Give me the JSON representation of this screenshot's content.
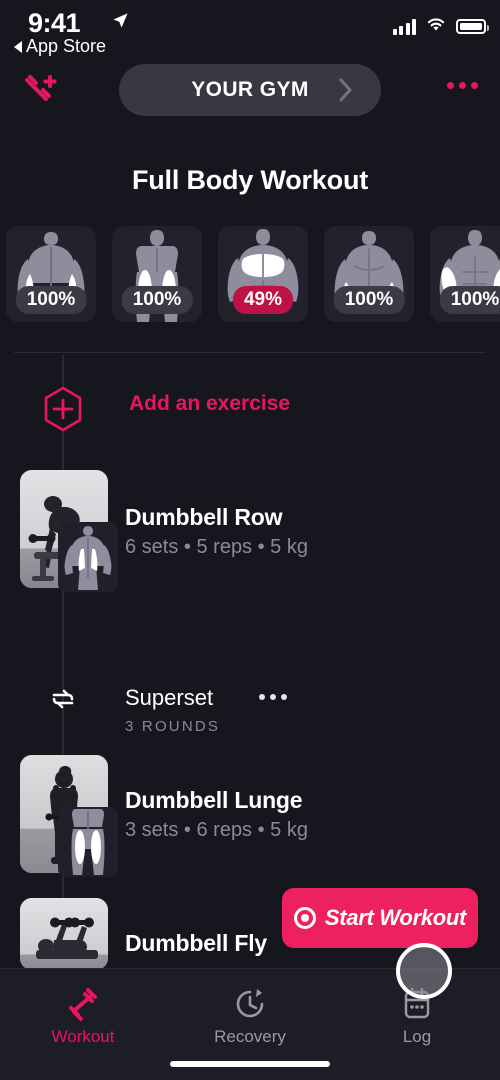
{
  "status_bar": {
    "time": "9:41",
    "back_label": "App Store",
    "location_icon": "location-arrow-icon",
    "signal_icon": "cellular-signal-icon",
    "wifi_icon": "wifi-icon",
    "battery_icon": "battery-full-icon"
  },
  "header": {
    "add_workout_icon": "dumbbell-plus-icon",
    "gym_label": "YOUR GYM",
    "gym_chevron_icon": "chevron-right-icon",
    "overflow_icon": "more-horizontal-icon"
  },
  "workout": {
    "title": "Full Body Workout",
    "muscle_cards": [
      {
        "name": "triceps-back",
        "percent": "100%",
        "highlight": false
      },
      {
        "name": "quadriceps-front",
        "percent": "100%",
        "highlight": false
      },
      {
        "name": "chest-front",
        "percent": "49%",
        "highlight": true
      },
      {
        "name": "triceps-rear",
        "percent": "100%",
        "highlight": false
      },
      {
        "name": "biceps-front",
        "percent": "100%",
        "highlight": false
      }
    ],
    "add_exercise": {
      "icon": "hexagon-plus-icon",
      "label": "Add an exercise"
    },
    "exercises": [
      {
        "name": "Dumbbell Row",
        "meta": "6 sets • 5 reps • 5 kg",
        "thumbnail": "person-bent-over-row-photo",
        "muscle_badge": "back-lats-diagram"
      },
      {
        "name": "Dumbbell Lunge",
        "meta": "3 sets • 6 reps • 5 kg",
        "thumbnail": "person-standing-dumbbells-photo",
        "muscle_badge": "quadriceps-diagram"
      },
      {
        "name": "Dumbbell Fly",
        "meta": "",
        "thumbnail": "person-bench-fly-photo",
        "muscle_badge": ""
      }
    ],
    "superset": {
      "icon": "repeat-icon",
      "title": "Superset",
      "overflow_icon": "more-horizontal-icon",
      "rounds": "3 ROUNDS"
    }
  },
  "start_button": {
    "label": "Start Workout",
    "icon": "record-circle-icon"
  },
  "tab_bar": {
    "tabs": [
      {
        "label": "Workout",
        "icon": "dumbbell-icon",
        "active": true
      },
      {
        "label": "Recovery",
        "icon": "clock-rotate-icon",
        "active": false
      },
      {
        "label": "Log",
        "icon": "calendar-log-icon",
        "active": false
      }
    ]
  },
  "colors": {
    "accent": "#e8165c",
    "accent_bright": "#ed2160",
    "badge_hot": "#be1145",
    "background": "#16161f",
    "surface": "#22222c",
    "muted_text": "#8b8b98"
  },
  "cursor": {
    "name": "touch-cursor"
  }
}
